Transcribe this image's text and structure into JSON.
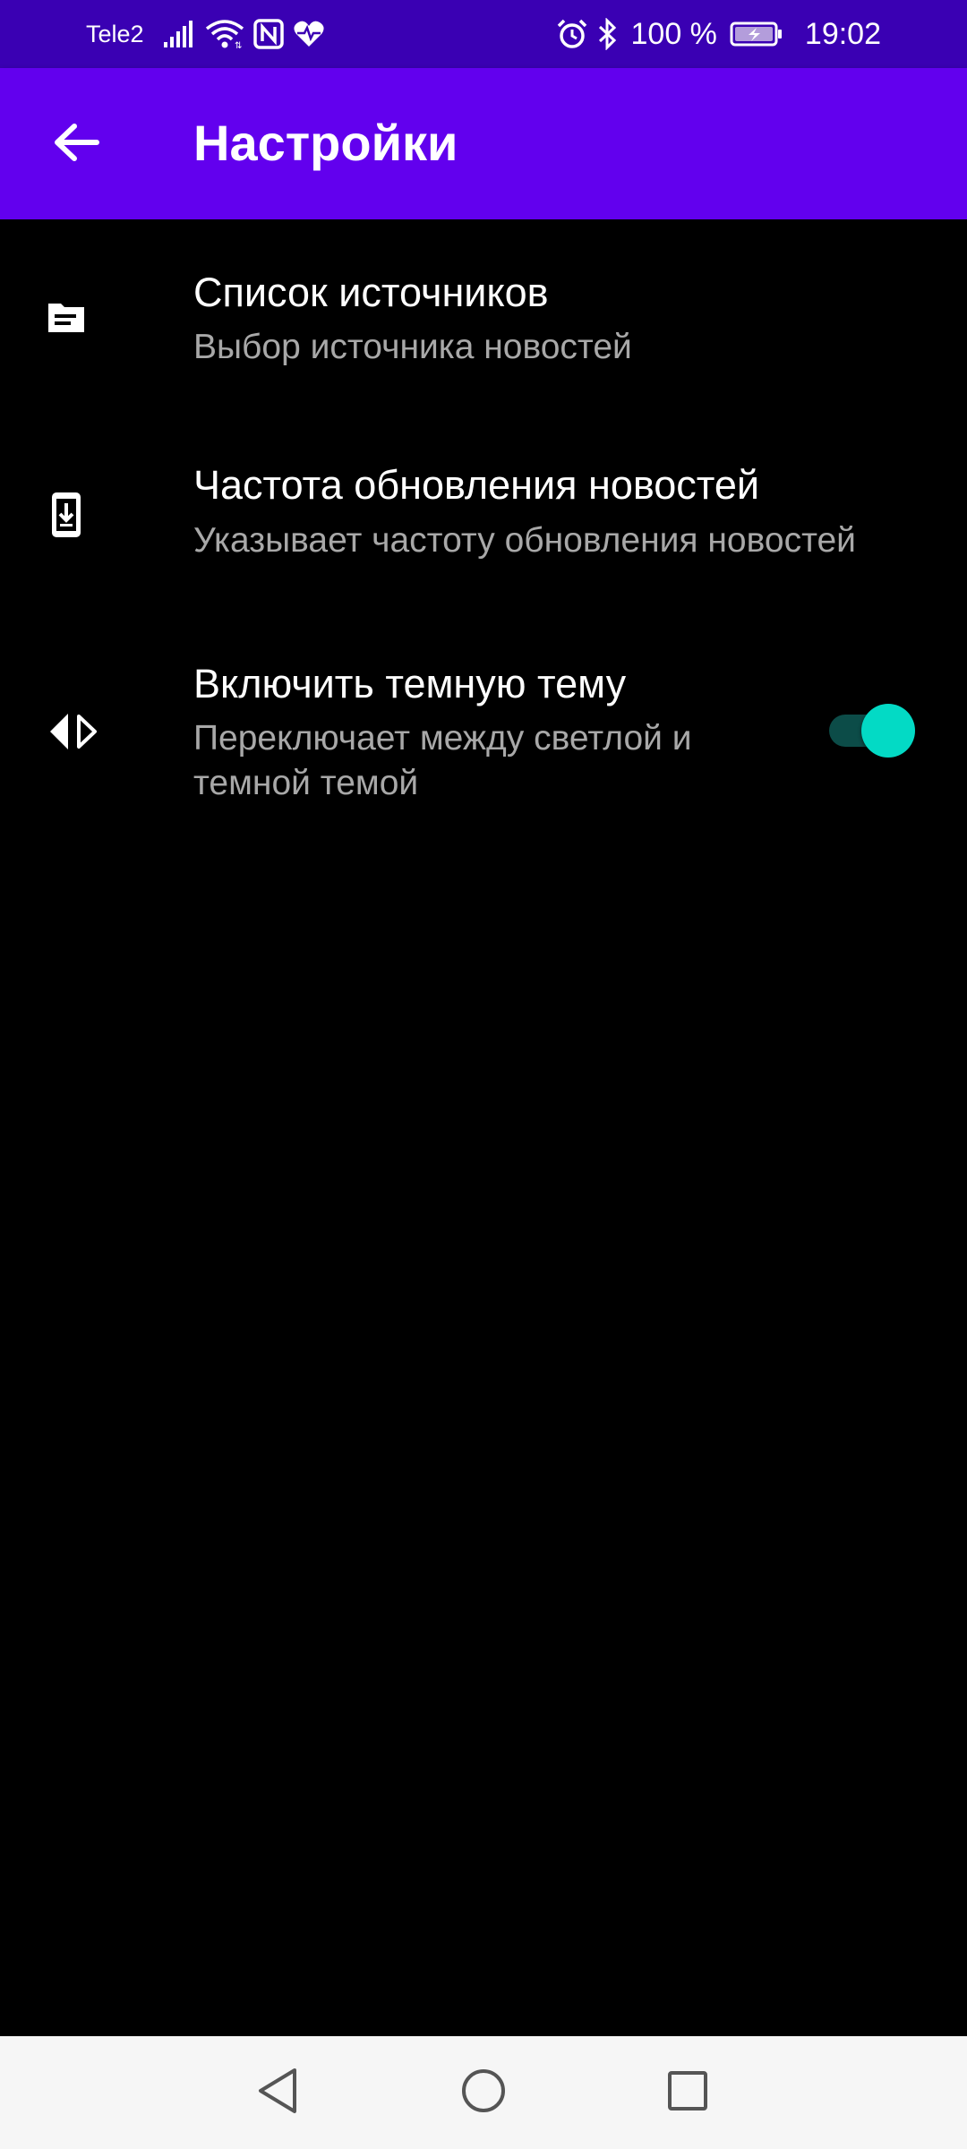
{
  "status_bar": {
    "carrier": "Tele2",
    "battery_percent": "100 %",
    "time": "19:02",
    "icons_left": [
      "signal-icon",
      "wifi-icon",
      "nfc-icon",
      "health-icon"
    ],
    "icons_right": [
      "alarm-icon",
      "bluetooth-icon",
      "battery-charging-icon"
    ]
  },
  "app_bar": {
    "title": "Настройки",
    "back_icon": "arrow-back-icon",
    "color": "#6200ee"
  },
  "settings": [
    {
      "icon": "document-icon",
      "title": "Список источников",
      "summary": "Выбор источника новостей"
    },
    {
      "icon": "download-icon",
      "title": "Частота обновления новостей",
      "summary": "Указывает частоту обновления новостей"
    },
    {
      "icon": "theme-contrast-icon",
      "title": "Включить темную тему",
      "summary": "Переключает между светлой и темной темой",
      "switch_on": true,
      "switch_color": "#03dac5"
    }
  ],
  "nav_bar": {
    "buttons": [
      "back-triangle-icon",
      "home-circle-icon",
      "recents-square-icon"
    ]
  },
  "colors": {
    "status_bar": "#3a00b3",
    "background": "#000000",
    "summary_text": "#a8a8a8"
  }
}
